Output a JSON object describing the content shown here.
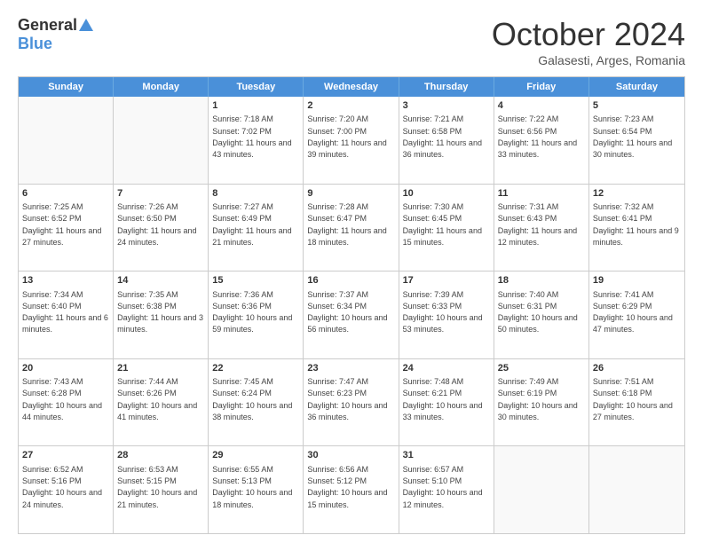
{
  "header": {
    "logo_general": "General",
    "logo_blue": "Blue",
    "month_title": "October 2024",
    "subtitle": "Galasesti, Arges, Romania"
  },
  "calendar": {
    "days": [
      "Sunday",
      "Monday",
      "Tuesday",
      "Wednesday",
      "Thursday",
      "Friday",
      "Saturday"
    ],
    "rows": [
      [
        {
          "day": "",
          "text": ""
        },
        {
          "day": "",
          "text": ""
        },
        {
          "day": "1",
          "text": "Sunrise: 7:18 AM\nSunset: 7:02 PM\nDaylight: 11 hours and 43 minutes."
        },
        {
          "day": "2",
          "text": "Sunrise: 7:20 AM\nSunset: 7:00 PM\nDaylight: 11 hours and 39 minutes."
        },
        {
          "day": "3",
          "text": "Sunrise: 7:21 AM\nSunset: 6:58 PM\nDaylight: 11 hours and 36 minutes."
        },
        {
          "day": "4",
          "text": "Sunrise: 7:22 AM\nSunset: 6:56 PM\nDaylight: 11 hours and 33 minutes."
        },
        {
          "day": "5",
          "text": "Sunrise: 7:23 AM\nSunset: 6:54 PM\nDaylight: 11 hours and 30 minutes."
        }
      ],
      [
        {
          "day": "6",
          "text": "Sunrise: 7:25 AM\nSunset: 6:52 PM\nDaylight: 11 hours and 27 minutes."
        },
        {
          "day": "7",
          "text": "Sunrise: 7:26 AM\nSunset: 6:50 PM\nDaylight: 11 hours and 24 minutes."
        },
        {
          "day": "8",
          "text": "Sunrise: 7:27 AM\nSunset: 6:49 PM\nDaylight: 11 hours and 21 minutes."
        },
        {
          "day": "9",
          "text": "Sunrise: 7:28 AM\nSunset: 6:47 PM\nDaylight: 11 hours and 18 minutes."
        },
        {
          "day": "10",
          "text": "Sunrise: 7:30 AM\nSunset: 6:45 PM\nDaylight: 11 hours and 15 minutes."
        },
        {
          "day": "11",
          "text": "Sunrise: 7:31 AM\nSunset: 6:43 PM\nDaylight: 11 hours and 12 minutes."
        },
        {
          "day": "12",
          "text": "Sunrise: 7:32 AM\nSunset: 6:41 PM\nDaylight: 11 hours and 9 minutes."
        }
      ],
      [
        {
          "day": "13",
          "text": "Sunrise: 7:34 AM\nSunset: 6:40 PM\nDaylight: 11 hours and 6 minutes."
        },
        {
          "day": "14",
          "text": "Sunrise: 7:35 AM\nSunset: 6:38 PM\nDaylight: 11 hours and 3 minutes."
        },
        {
          "day": "15",
          "text": "Sunrise: 7:36 AM\nSunset: 6:36 PM\nDaylight: 10 hours and 59 minutes."
        },
        {
          "day": "16",
          "text": "Sunrise: 7:37 AM\nSunset: 6:34 PM\nDaylight: 10 hours and 56 minutes."
        },
        {
          "day": "17",
          "text": "Sunrise: 7:39 AM\nSunset: 6:33 PM\nDaylight: 10 hours and 53 minutes."
        },
        {
          "day": "18",
          "text": "Sunrise: 7:40 AM\nSunset: 6:31 PM\nDaylight: 10 hours and 50 minutes."
        },
        {
          "day": "19",
          "text": "Sunrise: 7:41 AM\nSunset: 6:29 PM\nDaylight: 10 hours and 47 minutes."
        }
      ],
      [
        {
          "day": "20",
          "text": "Sunrise: 7:43 AM\nSunset: 6:28 PM\nDaylight: 10 hours and 44 minutes."
        },
        {
          "day": "21",
          "text": "Sunrise: 7:44 AM\nSunset: 6:26 PM\nDaylight: 10 hours and 41 minutes."
        },
        {
          "day": "22",
          "text": "Sunrise: 7:45 AM\nSunset: 6:24 PM\nDaylight: 10 hours and 38 minutes."
        },
        {
          "day": "23",
          "text": "Sunrise: 7:47 AM\nSunset: 6:23 PM\nDaylight: 10 hours and 36 minutes."
        },
        {
          "day": "24",
          "text": "Sunrise: 7:48 AM\nSunset: 6:21 PM\nDaylight: 10 hours and 33 minutes."
        },
        {
          "day": "25",
          "text": "Sunrise: 7:49 AM\nSunset: 6:19 PM\nDaylight: 10 hours and 30 minutes."
        },
        {
          "day": "26",
          "text": "Sunrise: 7:51 AM\nSunset: 6:18 PM\nDaylight: 10 hours and 27 minutes."
        }
      ],
      [
        {
          "day": "27",
          "text": "Sunrise: 6:52 AM\nSunset: 5:16 PM\nDaylight: 10 hours and 24 minutes."
        },
        {
          "day": "28",
          "text": "Sunrise: 6:53 AM\nSunset: 5:15 PM\nDaylight: 10 hours and 21 minutes."
        },
        {
          "day": "29",
          "text": "Sunrise: 6:55 AM\nSunset: 5:13 PM\nDaylight: 10 hours and 18 minutes."
        },
        {
          "day": "30",
          "text": "Sunrise: 6:56 AM\nSunset: 5:12 PM\nDaylight: 10 hours and 15 minutes."
        },
        {
          "day": "31",
          "text": "Sunrise: 6:57 AM\nSunset: 5:10 PM\nDaylight: 10 hours and 12 minutes."
        },
        {
          "day": "",
          "text": ""
        },
        {
          "day": "",
          "text": ""
        }
      ]
    ]
  }
}
